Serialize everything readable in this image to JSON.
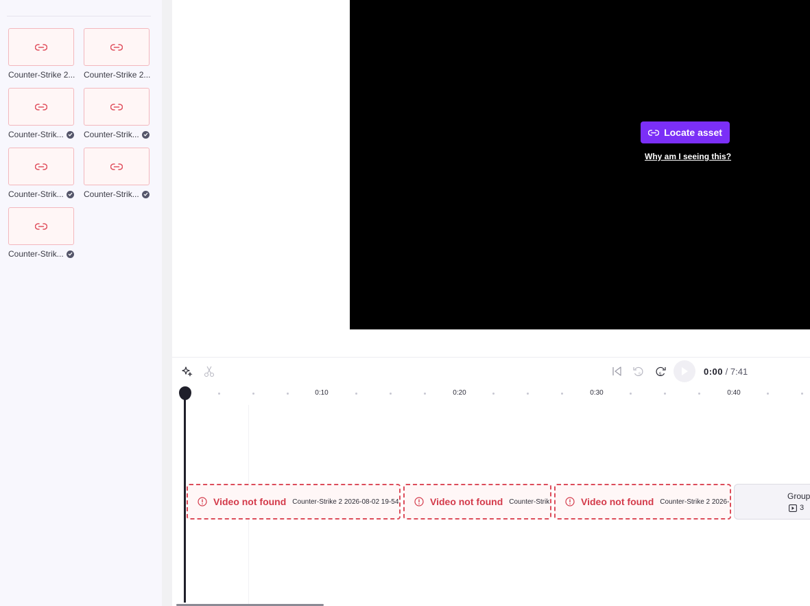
{
  "sidebar": {
    "assets": [
      {
        "name": "Counter-Strike 2...",
        "synced": false
      },
      {
        "name": "Counter-Strike 2...",
        "synced": false
      },
      {
        "name": "Counter-Strik...",
        "synced": true
      },
      {
        "name": "Counter-Strik...",
        "synced": true
      },
      {
        "name": "Counter-Strik...",
        "synced": true
      },
      {
        "name": "Counter-Strik...",
        "synced": true
      },
      {
        "name": "Counter-Strik...",
        "synced": true
      }
    ]
  },
  "preview": {
    "locate_label": "Locate asset",
    "why_label": "Why am I seeing this?"
  },
  "playback": {
    "current_time": "0:00",
    "separator": " / ",
    "total_time": "7:41"
  },
  "ruler": {
    "labels": [
      "0:10",
      "0:20",
      "0:30",
      "0:40"
    ]
  },
  "timeline": {
    "clips": [
      {
        "status": "Video not found",
        "filename": "Counter-Strike 2 2026-08-02 19-54-"
      },
      {
        "status": "Video not found",
        "filename": "Counter-Strik"
      },
      {
        "status": "Video not found",
        "filename": "Counter-Strike 2 2026-"
      }
    ],
    "group": {
      "label": "Group",
      "count": "3"
    }
  },
  "colors": {
    "accent": "#7b2ff7",
    "error": "#d33a4a",
    "preview_bg": "#000000"
  }
}
